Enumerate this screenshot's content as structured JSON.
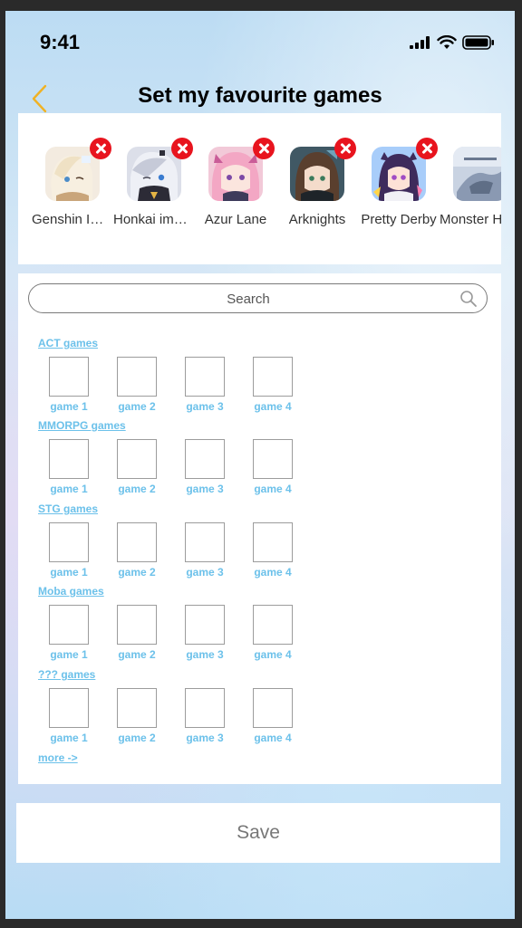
{
  "status_bar": {
    "time": "9:41"
  },
  "nav": {
    "title": "Set my favourite games"
  },
  "favourites": [
    {
      "name": "Genshin Impact",
      "label": "Genshin Impact",
      "icon": "genshin-game-icon",
      "colors": [
        "#f4e9dc",
        "#d9c0a0"
      ]
    },
    {
      "name": "Honkai impact",
      "label": "Honkai impact",
      "icon": "honkai-game-icon",
      "colors": [
        "#d8dcea",
        "#2b2a33"
      ]
    },
    {
      "name": "Azur Lane",
      "label": "Azur Lane",
      "icon": "azur-lane-game-icon",
      "colors": [
        "#f4b7cc",
        "#ad6fb8"
      ]
    },
    {
      "name": "Arknights",
      "label": "Arknights",
      "icon": "arknights-game-icon",
      "colors": [
        "#5c7b8a",
        "#28323a"
      ]
    },
    {
      "name": "Pretty Derby",
      "label": "Pretty Derby",
      "icon": "pretty-derby-game-icon",
      "colors": [
        "#b4d5ff",
        "#c67ad3"
      ]
    },
    {
      "name": "Monster Hunter",
      "label": "Monster Hunter",
      "icon": "monster-hunter-game-icon",
      "colors": [
        "#cfd8e6",
        "#7b8ca6"
      ]
    }
  ],
  "search": {
    "placeholder": "Search"
  },
  "sections": [
    {
      "title": "ACT games",
      "games": [
        "game 1",
        "game 2",
        "game 3",
        "game 4"
      ]
    },
    {
      "title": "MMORPG games",
      "games": [
        "game 1",
        "game 2",
        "game 3",
        "game 4"
      ]
    },
    {
      "title": "STG games",
      "games": [
        "game 1",
        "game 2",
        "game 3",
        "game 4"
      ]
    },
    {
      "title": "Moba games",
      "games": [
        "game 1",
        "game 2",
        "game 3",
        "game 4"
      ]
    },
    {
      "title": "??? games",
      "games": [
        "game 1",
        "game 2",
        "game 3",
        "game 4"
      ]
    }
  ],
  "more_label": "more ->",
  "save_label": "Save",
  "colors": {
    "accent_link": "#6cc1ea",
    "remove_badge": "#e8141e",
    "back_chevron": "#f0b224"
  }
}
